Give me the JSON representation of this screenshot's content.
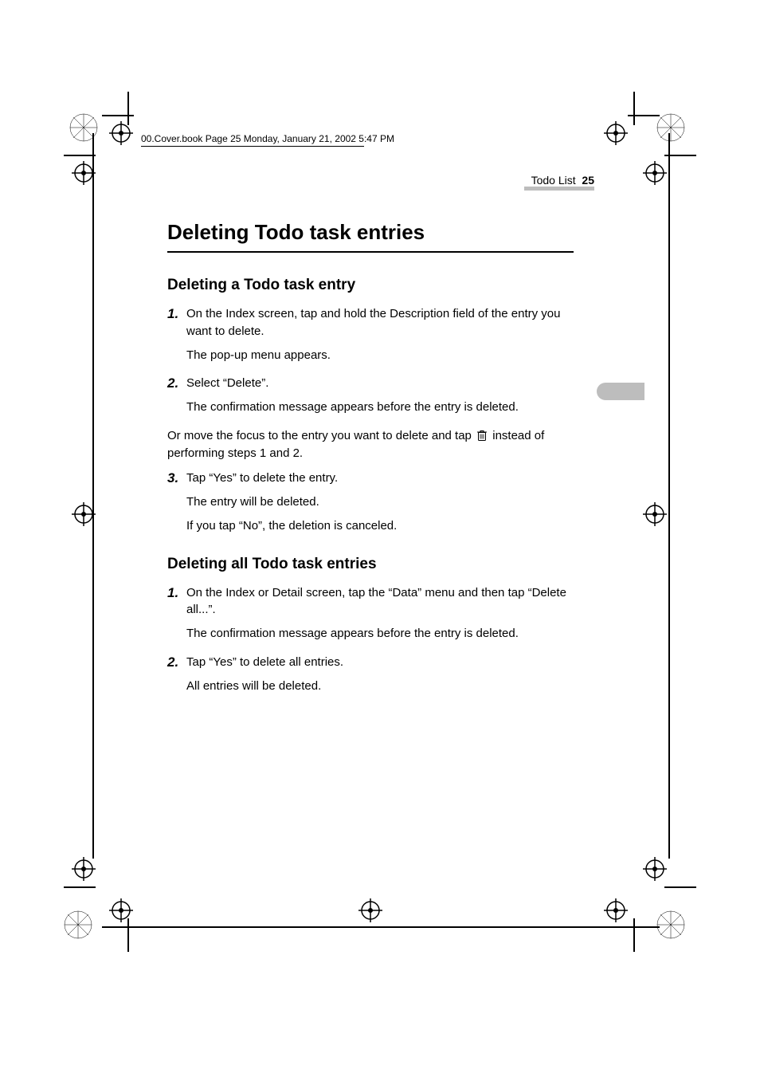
{
  "header": {
    "line": "00.Cover.book  Page 25  Monday, January 21, 2002  5:47 PM"
  },
  "running": {
    "section": "Todo List",
    "page": "25"
  },
  "title": "Deleting Todo task entries",
  "section1": {
    "heading": "Deleting a Todo task entry",
    "step1": {
      "num": "1.",
      "text": "On the Index screen, tap and hold the Description field of the entry you want to delete.",
      "result": "The pop-up menu appears."
    },
    "step2": {
      "num": "2.",
      "text": "Select “Delete”.",
      "result": "The confirmation message appears before the entry is deleted."
    },
    "alt_before": "Or move the focus to the entry you want to delete and tap ",
    "alt_after": " instead of performing steps 1 and 2.",
    "step3": {
      "num": "3.",
      "text": "Tap “Yes” to delete the entry.",
      "result1": "The entry will be deleted.",
      "result2": "If you tap “No”, the deletion is canceled."
    }
  },
  "section2": {
    "heading": "Deleting all Todo task entries",
    "step1": {
      "num": "1.",
      "text": "On the Index or Detail screen, tap the “Data” menu and then tap “Delete all...”.",
      "result": "The confirmation message appears before the entry is deleted."
    },
    "step2": {
      "num": "2.",
      "text": "Tap “Yes” to delete all entries.",
      "result": "All entries will be deleted."
    }
  }
}
